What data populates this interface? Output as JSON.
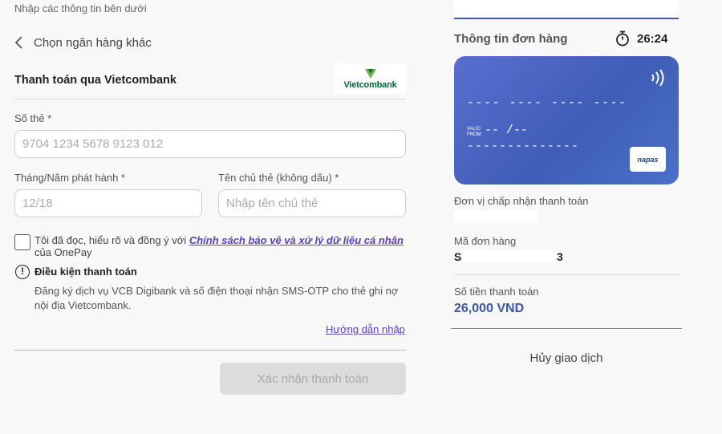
{
  "header": {
    "hint": "Nhập các thông tin bên dưới"
  },
  "back": {
    "label": "Chọn ngân hàng khác"
  },
  "payment": {
    "title": "Thanh toán qua Vietcombank",
    "bank_name": "Vietcombank"
  },
  "form": {
    "card_number": {
      "label": "Số thẻ *",
      "placeholder": "9704 1234 5678 9123 012"
    },
    "issue_date": {
      "label": "Tháng/Năm phát hành *",
      "placeholder": "12/18"
    },
    "holder_name": {
      "label": "Tên chủ thẻ (không dấu) *",
      "placeholder": "Nhập tên chủ thẻ"
    },
    "agree_prefix": "Tôi đã đọc, hiểu rõ và đồng ý với ",
    "agree_link": "Chính sách bảo vệ và xử lý dữ liệu cá nhân",
    "agree_suffix": " của OnePay",
    "condition_title": "Điều kiện thanh toán",
    "condition_text": "Đăng ký dịch vụ VCB Digibank và số điện thoại nhận SMS-OTP cho thẻ ghi nợ nội địa Vietcombank.",
    "guide_link": "Hướng dẫn nhập",
    "confirm_button": "Xác nhận thanh toán"
  },
  "order": {
    "title": "Thông tin đơn hàng",
    "timer": "26:24",
    "card_preview": {
      "number": "---- ---- ---- ----",
      "valid_label_1": "VALID",
      "valid_label_2": "FROM",
      "valid_value": "-- /--",
      "holder": "--------------",
      "network": "napas"
    },
    "merchant_label": "Đơn vị chấp nhận thanh toán",
    "order_id_label": "Mã đơn hàng",
    "order_id_prefix": "S",
    "order_id_suffix": "3",
    "amount_label": "Số tiền thanh toán",
    "amount": "26,000 VND",
    "cancel": "Hủy giao dịch"
  },
  "colors": {
    "accent": "#3a56a8",
    "link": "#5a3fc0",
    "card_bg": "#4a63c4",
    "vcb_green": "#00663a"
  }
}
